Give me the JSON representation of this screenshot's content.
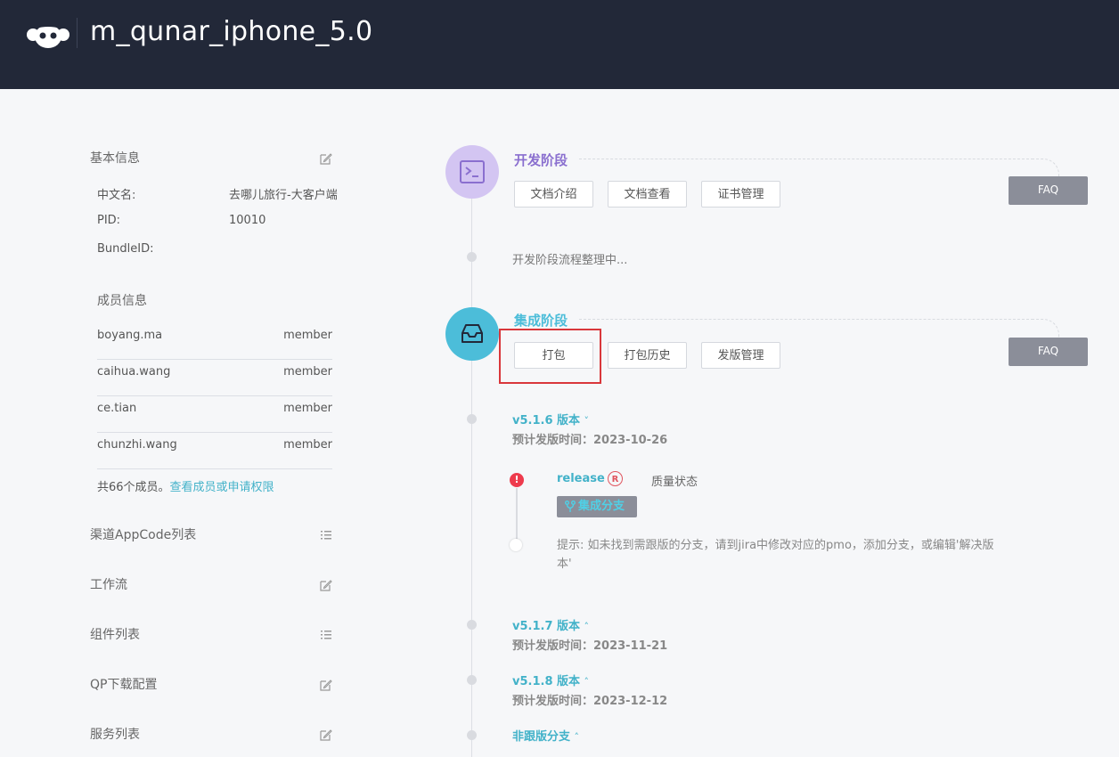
{
  "header": {
    "app_title": "m_qunar_iphone_5.0",
    "logo_icon": "monkey-face-logo"
  },
  "sidebar": {
    "basic_info": {
      "title": "基本信息",
      "fields": [
        {
          "label": "中文名:",
          "value": "去哪儿旅行-大客户端"
        },
        {
          "label": "PID:",
          "value": "10010"
        },
        {
          "label": "BundleID:",
          "value": ""
        }
      ]
    },
    "members": {
      "title": "成员信息",
      "list": [
        {
          "name": "boyang.ma",
          "role": "member"
        },
        {
          "name": "caihua.wang",
          "role": "member"
        },
        {
          "name": "ce.tian",
          "role": "member"
        },
        {
          "name": "chunzhi.wang",
          "role": "member"
        }
      ],
      "summary_prefix": "共66个成员。",
      "summary_link": "查看成员或申请权限"
    },
    "sections": [
      {
        "label": "渠道AppCode列表",
        "icon": "list-icon"
      },
      {
        "label": "工作流",
        "icon": "edit-icon"
      },
      {
        "label": "组件列表",
        "icon": "list-icon"
      },
      {
        "label": "QP下载配置",
        "icon": "edit-icon"
      },
      {
        "label": "服务列表",
        "icon": "edit-icon"
      }
    ]
  },
  "dev_stage": {
    "title": "开发阶段",
    "icon": "terminal-icon",
    "buttons": [
      "文档介绍",
      "文档查看",
      "证书管理"
    ],
    "faq": "FAQ",
    "note": "开发阶段流程整理中..."
  },
  "integration_stage": {
    "title": "集成阶段",
    "icon": "inbox-icon",
    "buttons": [
      "打包",
      "打包历史",
      "发版管理"
    ],
    "faq": "FAQ",
    "versions": [
      {
        "label": "v5.1.6 版本",
        "chevron": "˅",
        "date": "预计发版时间：2023-10-26"
      },
      {
        "label": "v5.1.7 版本",
        "chevron": "˄",
        "date": "预计发版时间：2023-11-21"
      },
      {
        "label": "v5.1.8 版本",
        "chevron": "˄",
        "date": "预计发版时间：2023-12-12"
      },
      {
        "label": "非跟版分支",
        "chevron": "˄",
        "date": ""
      }
    ],
    "release": {
      "alert": "!",
      "label": "release",
      "badge": "R",
      "quality": "质量状态",
      "branch_tag": "集成分支",
      "hint": "提示: 如未找到需跟版的分支，请到jira中修改对应的pmo，添加分支，或编辑'解决版本'"
    }
  },
  "colors": {
    "header_bg": "#222838",
    "dev_accent": "#8a6fcf",
    "integration_accent": "#4cbdd9",
    "link": "#43b2c9",
    "alert": "#ee3b4d",
    "highlight": "#d9373b",
    "faq_bg": "#8b8e99"
  }
}
